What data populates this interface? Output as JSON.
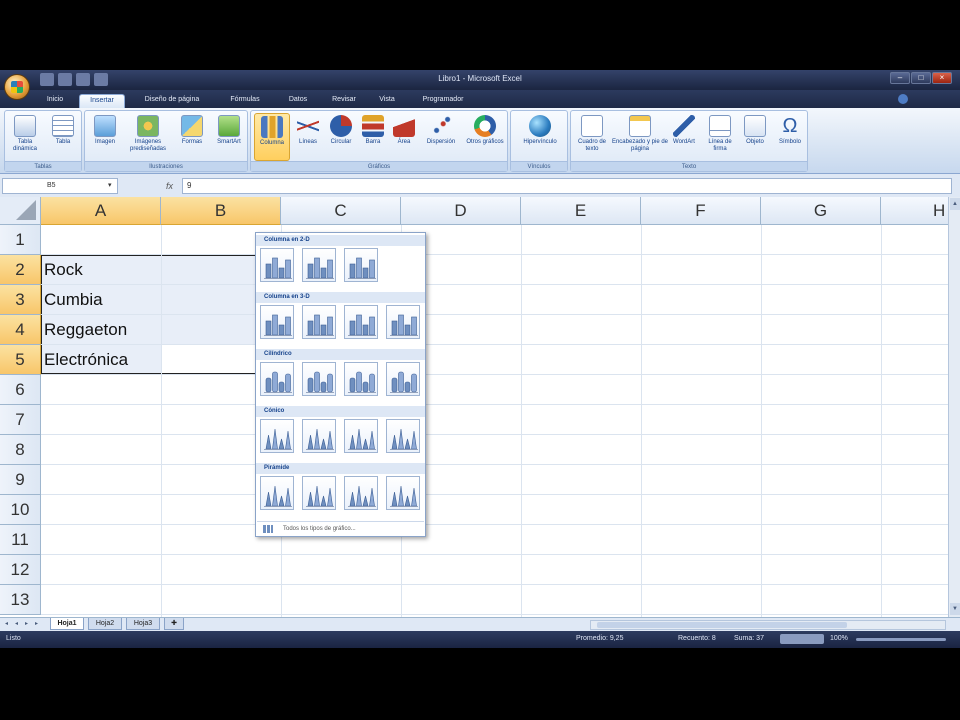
{
  "window": {
    "title": "Libro1 - Microsoft Excel"
  },
  "tabs": [
    "Inicio",
    "Insertar",
    "Diseño de página",
    "Fórmulas",
    "Datos",
    "Revisar",
    "Vista",
    "Programador"
  ],
  "ribbon": {
    "buttons": {
      "tabla_dinamica": "Tabla dinámica",
      "tabla": "Tabla",
      "imagen": "Imagen",
      "imagenes_predisenadas": "Imágenes prediseñadas",
      "formas": "Formas",
      "smartart": "SmartArt",
      "columna": "Columna",
      "lineas": "Líneas",
      "circular": "Circular",
      "barra": "Barra",
      "area": "Área",
      "dispersion": "Dispersión",
      "otros_graficos": "Otros gráficos",
      "hipervinculo": "Hipervínculo",
      "cuadro_texto": "Cuadro de texto",
      "encabezado": "Encabezado y pie de página",
      "wordart": "WordArt",
      "linea_firma": "Línea de firma",
      "objeto": "Objeto",
      "simbolo": "Símbolo"
    },
    "groups": {
      "tablas": "Tablas",
      "ilustraciones": "Ilustraciones",
      "graficos": "Gráficos",
      "vinculos": "Vínculos",
      "texto": "Texto"
    }
  },
  "formula_bar": {
    "name_box": "B5",
    "fx": "fx",
    "value": "9"
  },
  "columns": [
    "A",
    "B",
    "C",
    "D",
    "E",
    "F",
    "G",
    "H"
  ],
  "rows": [
    "1",
    "2",
    "3",
    "4",
    "5",
    "6",
    "7",
    "8",
    "9",
    "10",
    "11",
    "12",
    "13"
  ],
  "cells": {
    "A2": "Rock",
    "A3": "Cumbia",
    "A4": "Reggaeton",
    "A5": "Electrónica"
  },
  "gallery": {
    "sections": [
      "Columna en 2-D",
      "Columna en 3-D",
      "Cilíndrico",
      "Cónico",
      "Pirámide"
    ],
    "footer": "Todos los tipos de gráfico..."
  },
  "sheets": [
    "Hoja1",
    "Hoja2",
    "Hoja3"
  ],
  "status": {
    "mode": "Listo",
    "promedio": "Promedio: 9,25",
    "recuento": "Recuento: 8",
    "suma": "Suma: 37",
    "zoom": "100%"
  },
  "colors": {
    "selection_header": "#f8c66a",
    "ribbon_active": "#ffcf5e",
    "chart_blue": "#6f8fbf"
  }
}
